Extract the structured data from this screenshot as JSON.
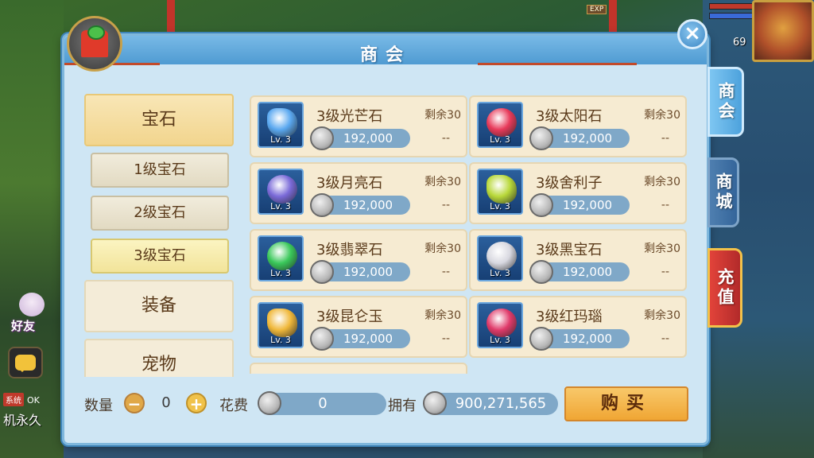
{
  "hud": {
    "friend_label": "好友",
    "chat_tag": "系统",
    "chat_ok": "OK",
    "chat_text": "机永久",
    "level": "69",
    "exp_label": "EXP"
  },
  "panel": {
    "title": "商会"
  },
  "side_tabs": [
    {
      "label": "商会"
    },
    {
      "label": "商城"
    },
    {
      "label": "充值"
    }
  ],
  "categories": {
    "gem": "宝石",
    "subs": [
      {
        "label": "1级宝石"
      },
      {
        "label": "2级宝石"
      },
      {
        "label": "3级宝石"
      }
    ],
    "equip": "装备",
    "pet": "宠物"
  },
  "items": [
    {
      "name": "3级光芒石",
      "remain": "剩余30",
      "price": "192,000",
      "lv": "Lv. 3",
      "dash": "--",
      "color": "#5aa8f0"
    },
    {
      "name": "3级太阳石",
      "remain": "剩余30",
      "price": "192,000",
      "lv": "Lv. 3",
      "dash": "--",
      "color": "#e83a5a"
    },
    {
      "name": "3级月亮石",
      "remain": "剩余30",
      "price": "192,000",
      "lv": "Lv. 3",
      "dash": "--",
      "color": "#7a6ad8"
    },
    {
      "name": "3级舍利子",
      "remain": "剩余30",
      "price": "192,000",
      "lv": "Lv. 3",
      "dash": "--",
      "color": "#b8d83a"
    },
    {
      "name": "3级翡翠石",
      "remain": "剩余30",
      "price": "192,000",
      "lv": "Lv. 3",
      "dash": "--",
      "color": "#3ac85a"
    },
    {
      "name": "3级黑宝石",
      "remain": "剩余30",
      "price": "192,000",
      "lv": "Lv. 3",
      "dash": "--",
      "color": "#d8d8e0"
    },
    {
      "name": "3级昆仑玉",
      "remain": "剩余30",
      "price": "192,000",
      "lv": "Lv. 3",
      "dash": "--",
      "color": "#f0b83a"
    },
    {
      "name": "3级红玛瑙",
      "remain": "剩余30",
      "price": "192,000",
      "lv": "Lv. 3",
      "dash": "--",
      "color": "#e03a6a"
    }
  ],
  "bottom": {
    "qty_label": "数量",
    "qty_value": "0",
    "minus": "−",
    "plus": "+",
    "cost_label": "花费",
    "cost_value": "0",
    "own_label": "拥有",
    "own_value": "900,271,565",
    "buy_label": "购买"
  }
}
